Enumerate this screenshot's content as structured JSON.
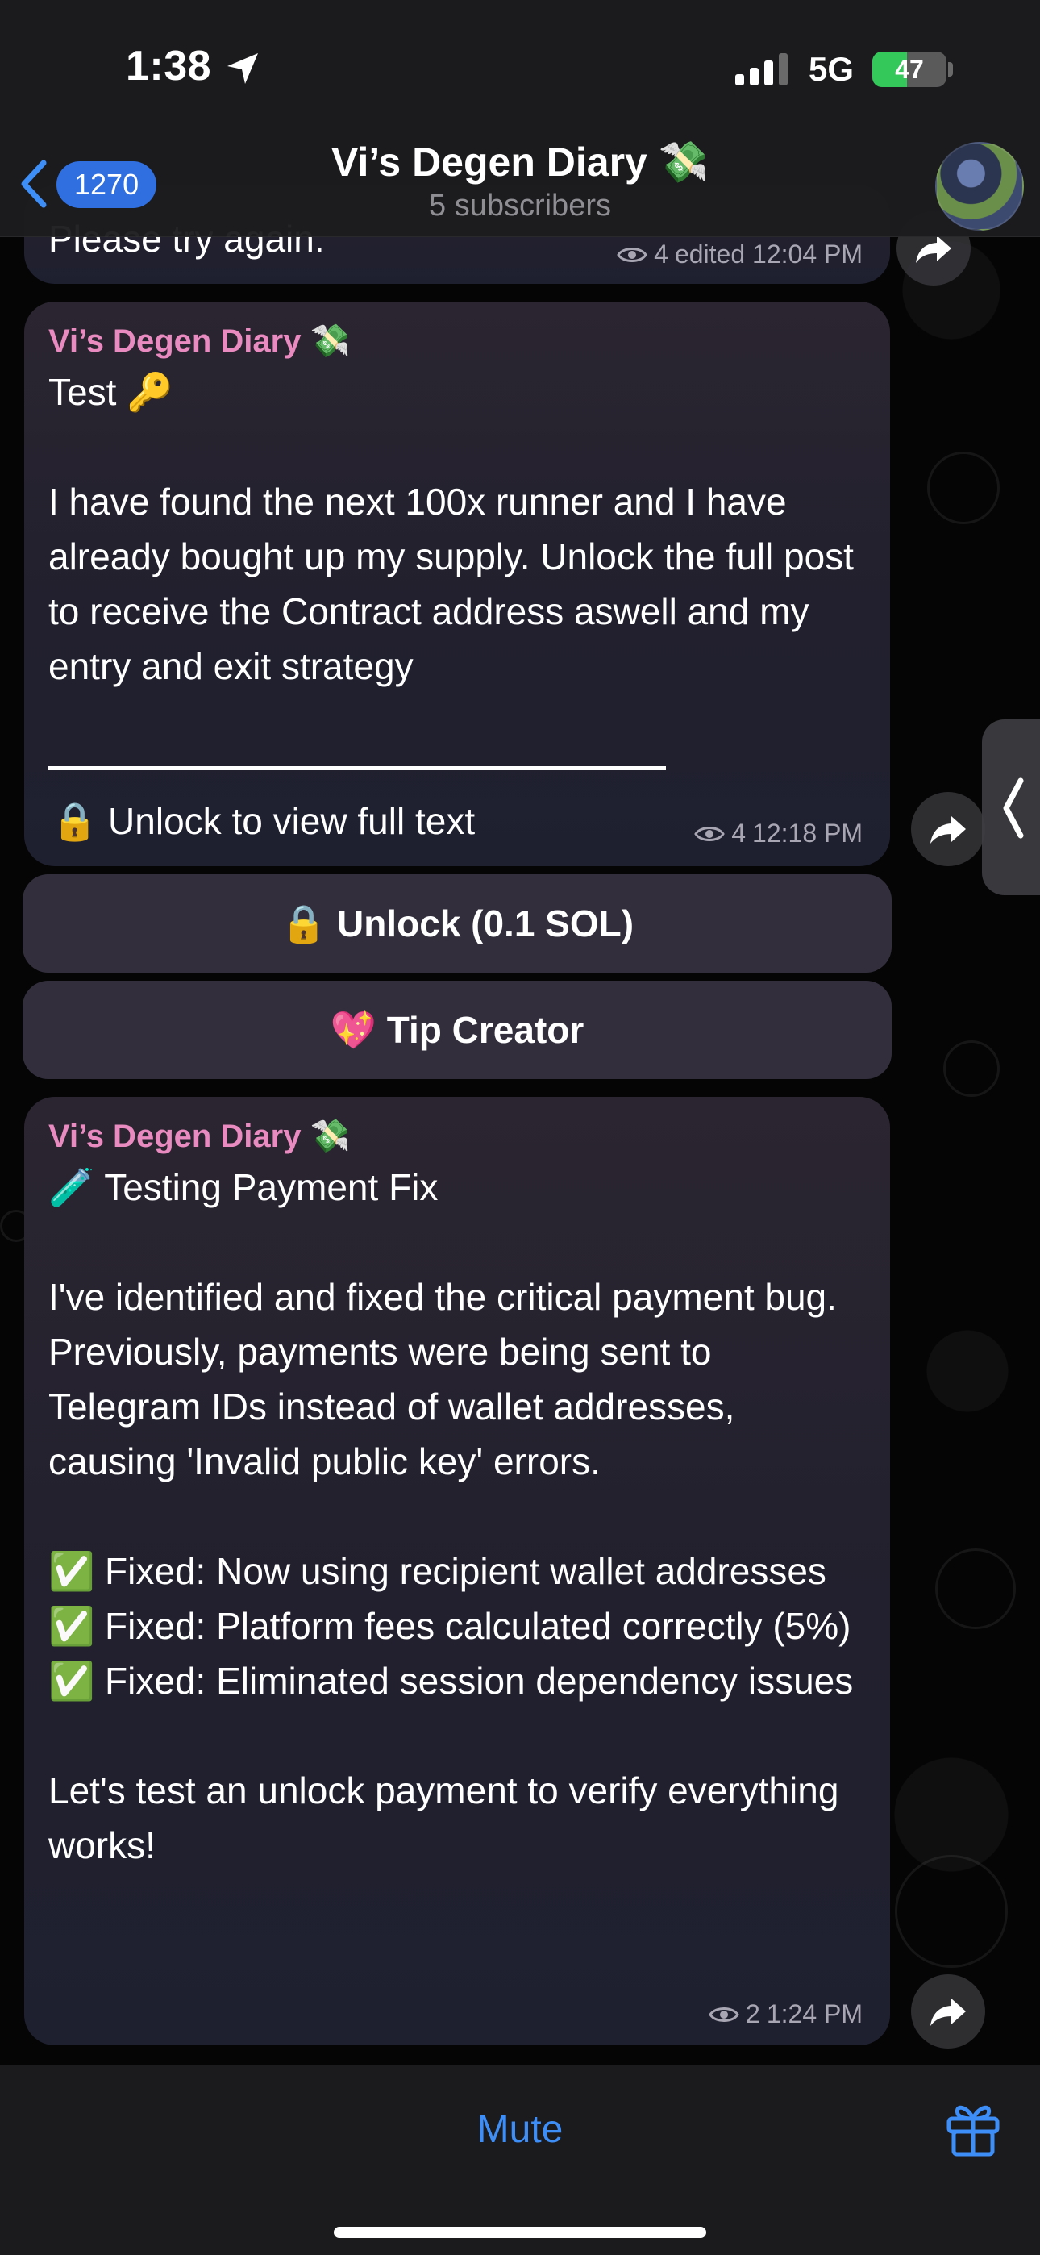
{
  "status_bar": {
    "time": "1:38",
    "network": "5G",
    "battery": "47",
    "battery_level": 0.47
  },
  "header": {
    "back_count": "1270",
    "title": "Vi’s Degen Diary 💸",
    "subtitle": "5 subscribers"
  },
  "messages": [
    {
      "text": "Please try again.",
      "views": "4",
      "time": "edited 12:04 PM"
    },
    {
      "sender": "Vi’s Degen Diary 💸",
      "text": "Test 🔑\n\nI have found the next 100x runner and I have already bought up my supply. Unlock the full post to receive the Contract address aswell and my entry and exit strategy",
      "locked_text": "🔒 Unlock to view full text",
      "views": "4",
      "time": "12:18 PM",
      "buttons": [
        {
          "label": "🔒 Unlock (0.1 SOL)"
        },
        {
          "label": "💖 Tip Creator"
        }
      ]
    },
    {
      "sender": "Vi’s Degen Diary 💸",
      "text": "🧪 Testing Payment Fix\n\nI've identified and fixed the critical payment bug. Previously, payments were being sent to Telegram IDs instead of wallet addresses, causing 'Invalid public key' errors.\n\n✅ Fixed: Now using recipient wallet addresses\n✅ Fixed: Platform fees calculated correctly (5%)\n✅ Fixed: Eliminated session dependency issues\n\nLet's test an unlock payment to verify everything works!",
      "views": "2",
      "time": "1:24 PM"
    }
  ],
  "bottom_bar": {
    "mute_label": "Mute"
  },
  "icons": {
    "location": "location-arrow-icon",
    "back": "chevron-left-icon",
    "forward": "share-forward-icon",
    "views": "eye-icon",
    "gift": "gift-icon"
  },
  "colors": {
    "accent": "#3e8ef7",
    "sender": "#e98ac0",
    "badge": "#2f6fe0",
    "battery": "#34c759"
  }
}
